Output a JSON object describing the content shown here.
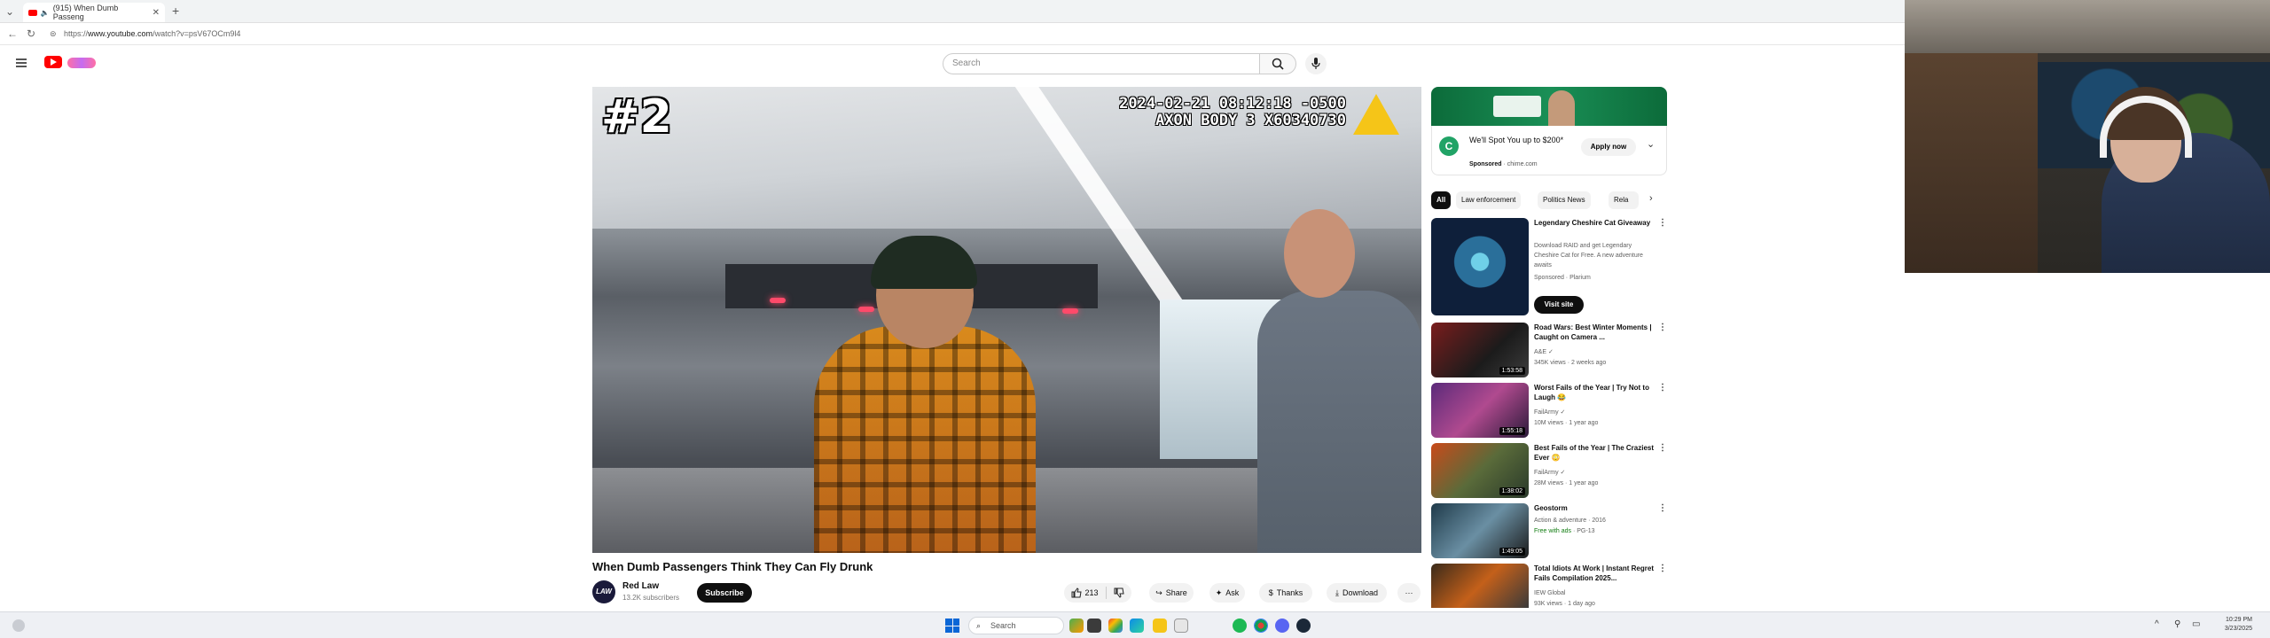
{
  "browser": {
    "tab_title": "(915) When Dumb Passeng",
    "tab_close": "✕",
    "new_tab": "+",
    "url_prefix": "https://",
    "url_host": "www.youtube.com",
    "url_path": "/watch?v=psV67OCm9l4"
  },
  "youtube": {
    "search_placeholder": "Search"
  },
  "video": {
    "overlay_number": "#2",
    "overlay_timestamp": "2024-02-21 08:12:18 -0500",
    "overlay_device": "AXON BODY 3 X60340730",
    "title": "When Dumb Passengers Think They Can Fly Drunk",
    "channel_name": "Red Law",
    "channel_avatar_text": "LAW",
    "channel_subs": "13.2K subscribers",
    "subscribe_label": "Subscribe",
    "like_count": "213",
    "share_label": "Share",
    "ask_label": "Ask",
    "thanks_label": "Thanks",
    "download_label": "Download",
    "more_label": "···"
  },
  "sidebar": {
    "ad": {
      "headline": "We'll Spot You up to $200*",
      "sponsored": "Sponsored",
      "domain": "· chime.com",
      "apply_label": "Apply now",
      "logo_letter": "C"
    },
    "chips": [
      "All",
      "Law enforcement",
      "Politics News",
      "Rela"
    ],
    "recs": [
      {
        "title": "Legendary Cheshire Cat Giveaway",
        "meta1": "Download RAID and get Legendary Cheshire Cat for Free. A new adventure awaits",
        "meta2": "Sponsored · Plarium",
        "action": "Visit site"
      },
      {
        "title": "Road Wars: Best Winter Moments | Caught on Camera ...",
        "meta1": "A&E ✓",
        "meta2": "345K views · 2 weeks ago",
        "duration": "1:53:58"
      },
      {
        "title": "Worst Fails of the Year | Try Not to Laugh 😂",
        "meta1": "FailArmy ✓",
        "meta2": "10M views · 1 year ago",
        "duration": "1:55:18"
      },
      {
        "title": "Best Fails of the Year | The Craziest Ever 😳",
        "meta1": "FailArmy ✓",
        "meta2": "28M views · 1 year ago",
        "duration": "1:38:02"
      },
      {
        "title": "Geostorm",
        "meta1": "Action & adventure · 2016",
        "meta2_free": "Free with ads",
        "meta2_rating": " · PG-13",
        "duration": "1:49:05"
      },
      {
        "title": "Total Idiots At Work | Instant Regret Fails Compilation 2025...",
        "meta1": "IEW Global",
        "meta2": "93K views · 1 day ago"
      }
    ]
  },
  "taskbar": {
    "search_label": "Search",
    "time": "10:29 PM",
    "date": "3/23/2025"
  }
}
